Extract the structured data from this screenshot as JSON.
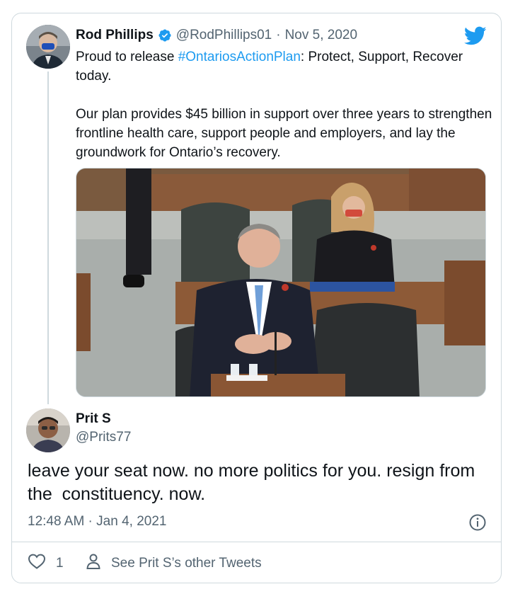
{
  "parent_tweet": {
    "name": "Rod Phillips",
    "handle": "@RodPhillips01",
    "separator": "·",
    "date": "Nov 5, 2020",
    "text_line1_prefix": "Proud to release ",
    "hashtag": "#OntariosActionPlan",
    "text_line1_suffix": ": Protect, Support, Recover today.",
    "text_paragraph2": "Our plan provides $45 billion in support over three years to strengthen frontline health care, support people and employers, and lay the groundwork for Ontario’s recovery."
  },
  "reply_tweet": {
    "name": "Prit S",
    "handle": "@Prits77",
    "text": "leave your seat now. no more politics for you. resign from the  constituency. now.",
    "timestamp": "12:48 AM · Jan 4, 2021"
  },
  "actions": {
    "like_count": "1",
    "other_tweets_label": "See Prit S’s other Tweets"
  },
  "colors": {
    "accent": "#1d9bf0",
    "secondary_text": "#536471",
    "border": "#cfd9de"
  },
  "icons": [
    "verified-badge-icon",
    "twitter-bird-icon",
    "info-icon",
    "heart-icon",
    "person-icon"
  ]
}
